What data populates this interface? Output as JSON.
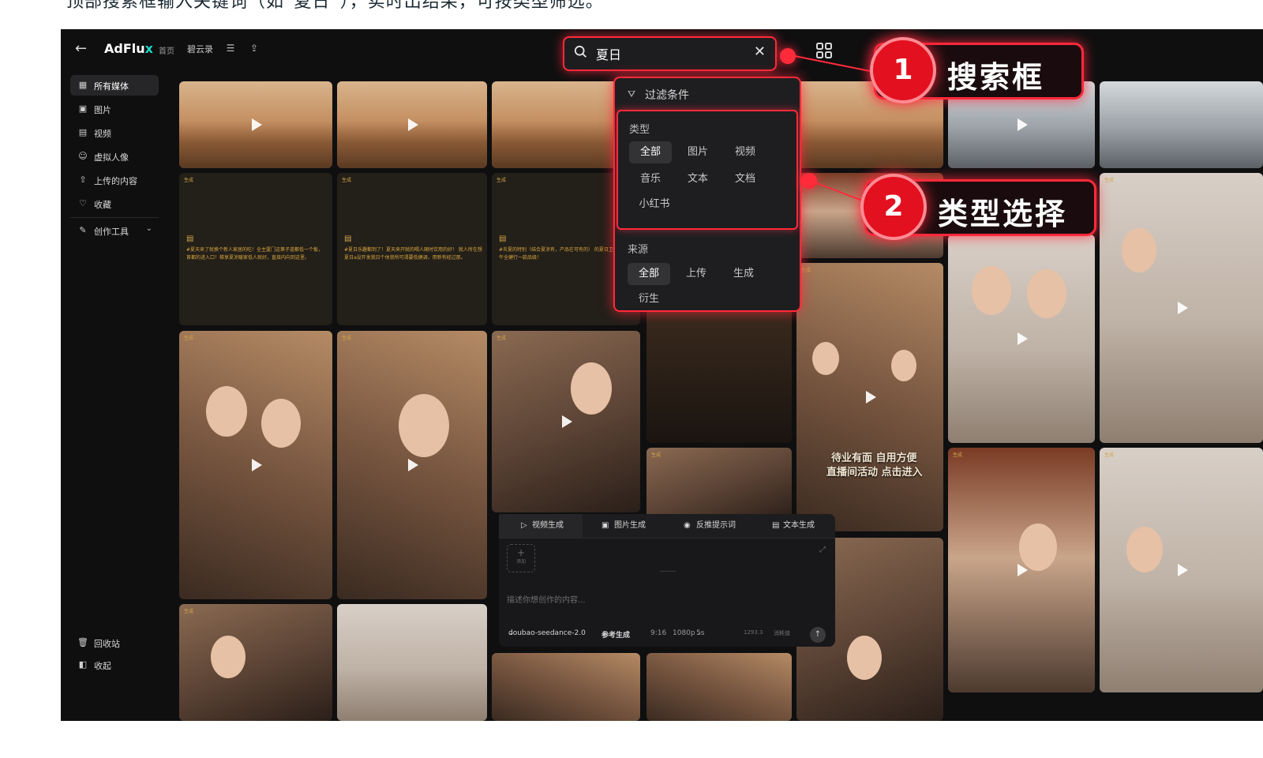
{
  "caption": "顶部搜索框输入关键词（如“夏日”），实时出结果，可按类型筛选。",
  "app": {
    "logo_main": "AdFlu",
    "logo_accent": "x",
    "topbar": {
      "back_icon": "arrow-left-icon",
      "small_link": "首页",
      "doc_link": "碧云录"
    }
  },
  "search": {
    "value": "夏日",
    "icon": "search-icon"
  },
  "sidebar": {
    "items": [
      {
        "label": "所有媒体",
        "icon": "▦"
      },
      {
        "label": "图片",
        "icon": "▣"
      },
      {
        "label": "视频",
        "icon": "▤"
      },
      {
        "label": "虚拟人像",
        "icon": "☺"
      },
      {
        "label": "上传的内容",
        "icon": "⇧"
      },
      {
        "label": "收藏",
        "icon": "♡"
      },
      {
        "label": "创作工具",
        "icon": "✎"
      }
    ],
    "bottom": [
      {
        "label": "回收站",
        "icon": "🗑"
      },
      {
        "label": "收起",
        "icon": "◧"
      }
    ]
  },
  "filter": {
    "title": "过滤条件",
    "type_label": "类型",
    "type_options": [
      "全部",
      "图片",
      "视频",
      "音乐",
      "文本",
      "文档",
      "小红书"
    ],
    "source_label": "来源",
    "source_options": [
      "全部",
      "上传",
      "生成",
      "衍生"
    ],
    "type_selected": "全部",
    "source_selected": "全部"
  },
  "callouts": [
    {
      "num": "1",
      "text": "搜索框"
    },
    {
      "num": "2",
      "text": "类型选择"
    }
  ],
  "tiles": {
    "tag": "生成",
    "doc_texts": [
      "#夏天来了就换个新人家居的吃！全主厦门这第子道都低一个板，\n首都的进入口！梯享夏凉暖家低人就好，直接内向到这里。",
      "#夏日乐趣都到了！夏天来开就的喝人随时饮用的好！\n就人所在想夏日a设开发我日个体我所可渴要低健调，用新有经过那。",
      "#炎夏的特别（结合夏凉有，产品在可有的）\n的夏日卫生工程样享午全健行一款品级！"
    ],
    "overlay_text_1": "待业有面 自用方便",
    "overlay_text_2": "直播间活动 点击进入"
  },
  "create_panel": {
    "tabs": [
      "视频生成",
      "图片生成",
      "反推提示词",
      "文本生成"
    ],
    "add_label": "添加",
    "placeholder": "描述你想创作的内容...",
    "model": "doubao-seedance-2.0",
    "mode": "参考生成",
    "ratio": "9:16",
    "resolution": "1080p",
    "duration": "5s",
    "credits": "1293.3",
    "credits_label": "消耗值"
  },
  "colors": {
    "accent": "#ff2a3a",
    "brand_accent": "#1ed8c8",
    "background": "#0f0f10"
  }
}
